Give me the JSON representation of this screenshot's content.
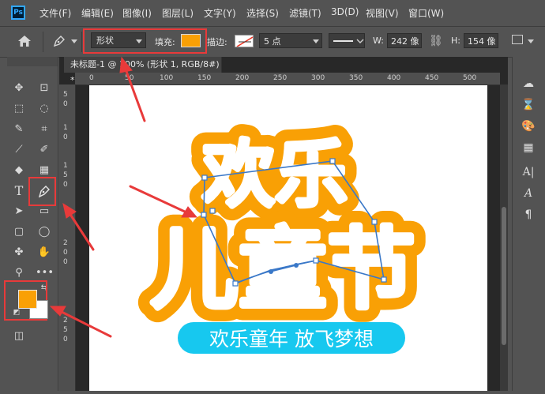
{
  "menu": {
    "logo": "Ps",
    "items": [
      "文件(F)",
      "编辑(E)",
      "图像(I)",
      "图层(L)",
      "文字(Y)",
      "选择(S)",
      "滤镜(T)",
      "3D(D)",
      "视图(V)",
      "窗口(W)"
    ]
  },
  "options": {
    "mode": "形状",
    "fill_label": "填充:",
    "fill_color": "#f9a005",
    "stroke_label": "描边:",
    "stroke_size": "5 点",
    "w_label": "W:",
    "w_value": "242 像",
    "h_label": "H:",
    "h_value": "154 像"
  },
  "document": {
    "tab_title": "未标题-1 @ 100% (形状 1, RGB/8#) *",
    "ruler_h": [
      "0",
      "50",
      "100",
      "150",
      "200",
      "250",
      "300",
      "350",
      "400",
      "450",
      "500"
    ],
    "ruler_v": [
      "5",
      "0",
      "1",
      "0",
      "1",
      "5",
      "0",
      "2",
      "0",
      "0",
      "2",
      "5",
      "0"
    ]
  },
  "artwork": {
    "line1": "欢乐",
    "line2": "儿童节",
    "banner": "欢乐童年 放飞梦想",
    "orange": "#f9a005",
    "cyan": "#17c8ef",
    "path_color": "#3a78c8"
  },
  "colors": {
    "foreground": "#f9a005",
    "background": "#ffffff",
    "annotation_red": "#e83a3a"
  },
  "icons": {
    "left_toolbar": [
      "move-icon",
      "artboard-icon",
      "marquee-icon",
      "lasso-icon",
      "quick-select-icon",
      "crop-icon",
      "eyedropper-icon",
      "brush-icon",
      "eraser-icon",
      "gradient-icon",
      "type-icon",
      "pen-icon",
      "path-select-icon",
      "rectangle-icon",
      "rounded-rect-icon",
      "ellipse-icon",
      "custom-shape-icon",
      "hand-icon",
      "zoom-icon",
      "more-icon",
      "quick-mask-icon"
    ],
    "right_panel": [
      "creative-cloud-icon",
      "history-icon",
      "color-icon",
      "swatches-icon",
      "character-icon",
      "glyphs-icon",
      "paragraph-icon"
    ]
  }
}
